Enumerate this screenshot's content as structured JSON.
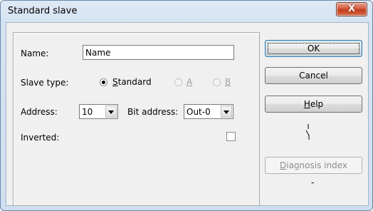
{
  "window": {
    "title": "Standard slave",
    "close_glyph": "X"
  },
  "form": {
    "name_label": "Name:",
    "name_value": "Name",
    "slave_type_label": "Slave type:",
    "slave_type_options": [
      {
        "label": "Standard",
        "selected": true,
        "enabled": true
      },
      {
        "label": "A",
        "selected": false,
        "enabled": false
      },
      {
        "label": "B",
        "selected": false,
        "enabled": false
      }
    ],
    "address_label": "Address:",
    "address_value": "10",
    "bit_address_label": "Bit address:",
    "bit_address_value": "Out-0",
    "inverted_label": "Inverted:",
    "inverted_checked": false
  },
  "buttons": {
    "ok": "OK",
    "cancel": "Cancel",
    "help": "Help",
    "diagnosis_index": "Diagnosis index"
  },
  "status": {
    "diagnosis_value": "-"
  },
  "icons": {
    "close": "close-icon",
    "switch": "switch-contact-icon"
  }
}
